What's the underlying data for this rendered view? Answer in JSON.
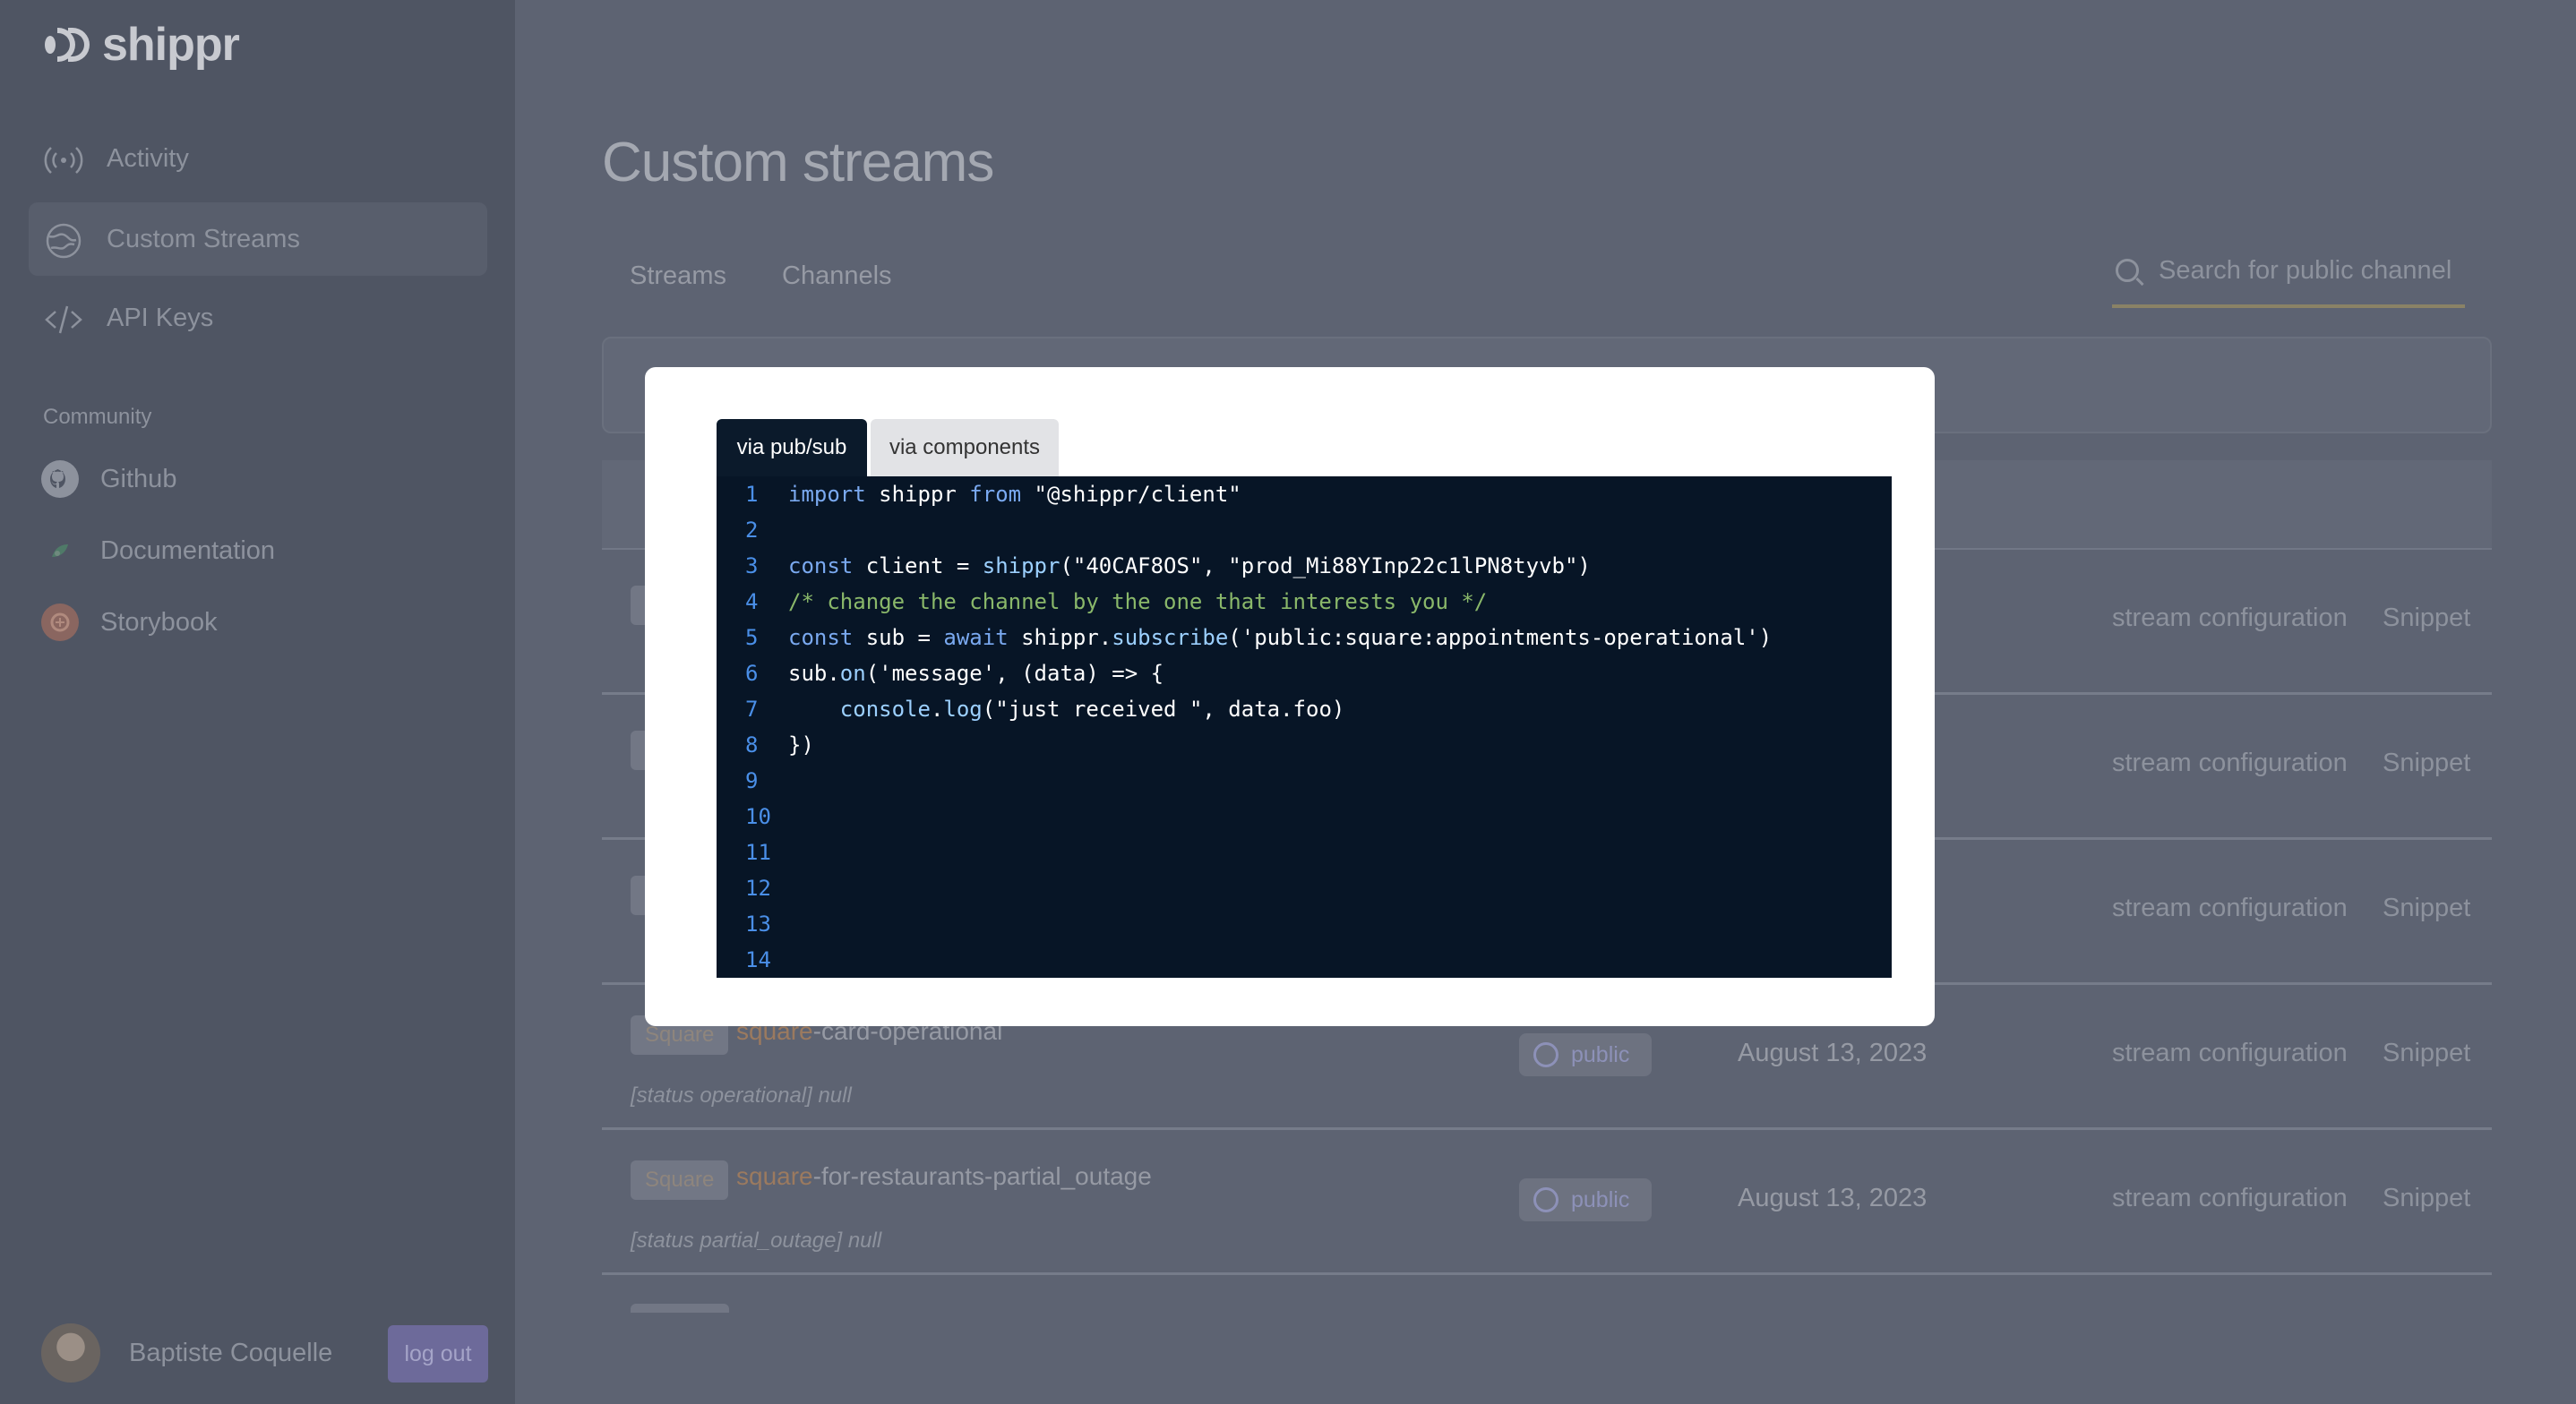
{
  "app": {
    "name": "shippr"
  },
  "sidebar": {
    "items": [
      {
        "label": "Activity",
        "icon": "broadcast-icon"
      },
      {
        "label": "Custom Streams",
        "icon": "globe-icon",
        "active": true
      },
      {
        "label": "API Keys",
        "icon": "code-icon"
      }
    ],
    "community_title": "Community",
    "community": [
      {
        "label": "Github",
        "icon": "github-icon"
      },
      {
        "label": "Documentation",
        "icon": "documentation-icon"
      },
      {
        "label": "Storybook",
        "icon": "storybook-icon"
      }
    ],
    "user": {
      "name": "Baptiste Coquelle",
      "logout_label": "log out"
    }
  },
  "main": {
    "title": "Custom streams",
    "tabs": [
      {
        "label": "Streams"
      },
      {
        "label": "Channels"
      }
    ],
    "search": {
      "placeholder": "Search for public channel"
    },
    "rows": [
      {
        "cfg": "stream configuration",
        "snippet": "Snippet"
      },
      {
        "cfg": "stream configuration",
        "snippet": "Snippet"
      },
      {
        "cfg": "stream configuration",
        "snippet": "Snippet"
      },
      {
        "badge": "Square",
        "name_prefix": "square",
        "name_suffix": "-card-operational",
        "status": "[status operational] null",
        "visibility": "public",
        "date": "August 13, 2023",
        "cfg": "stream configuration",
        "snippet": "Snippet"
      },
      {
        "badge": "Square",
        "name_prefix": "square",
        "name_suffix": "-for-restaurants-partial_outage",
        "status": "[status partial_outage] null",
        "visibility": "public",
        "date": "August 13, 2023",
        "cfg": "stream configuration",
        "snippet": "Snippet"
      }
    ]
  },
  "modal": {
    "tabs": [
      {
        "label": "via pub/sub",
        "active": true
      },
      {
        "label": "via components"
      }
    ],
    "code_lines": [
      {
        "n": "1"
      },
      {
        "n": "2"
      },
      {
        "n": "3"
      },
      {
        "n": "4"
      },
      {
        "n": "5"
      },
      {
        "n": "6"
      },
      {
        "n": "7"
      },
      {
        "n": "8"
      },
      {
        "n": "9"
      },
      {
        "n": "10"
      },
      {
        "n": "11"
      },
      {
        "n": "12"
      },
      {
        "n": "13"
      },
      {
        "n": "14"
      }
    ],
    "code": {
      "l1": {
        "a": "import",
        "b": " shippr ",
        "c": "from",
        "d": " \"@shippr/client\""
      },
      "l3": {
        "a": "const",
        "b": " client = ",
        "c": "shippr",
        "d": "(\"40CAF8OS\", \"prod_Mi88YInp22c1lPN8tyvb\")"
      },
      "l4": "/* change the channel by the one that interests you */",
      "l5": {
        "a": "const",
        "b": " sub = ",
        "c": "await",
        "d": " shippr.",
        "e": "subscribe",
        "f": "('public:square:appointments-operational')"
      },
      "l6": {
        "a": "sub.",
        "b": "on",
        "c": "('message', (data) => {"
      },
      "l7": {
        "a": "    ",
        "b": "console",
        "c": ".",
        "d": "log",
        "e": "(\"just received \", data.foo)"
      },
      "l8": "})"
    }
  },
  "colors": {
    "accent": "#6d6a9a",
    "code_bg": "#071526",
    "line_number": "#4a8fe8",
    "comment": "#8ab86a"
  }
}
